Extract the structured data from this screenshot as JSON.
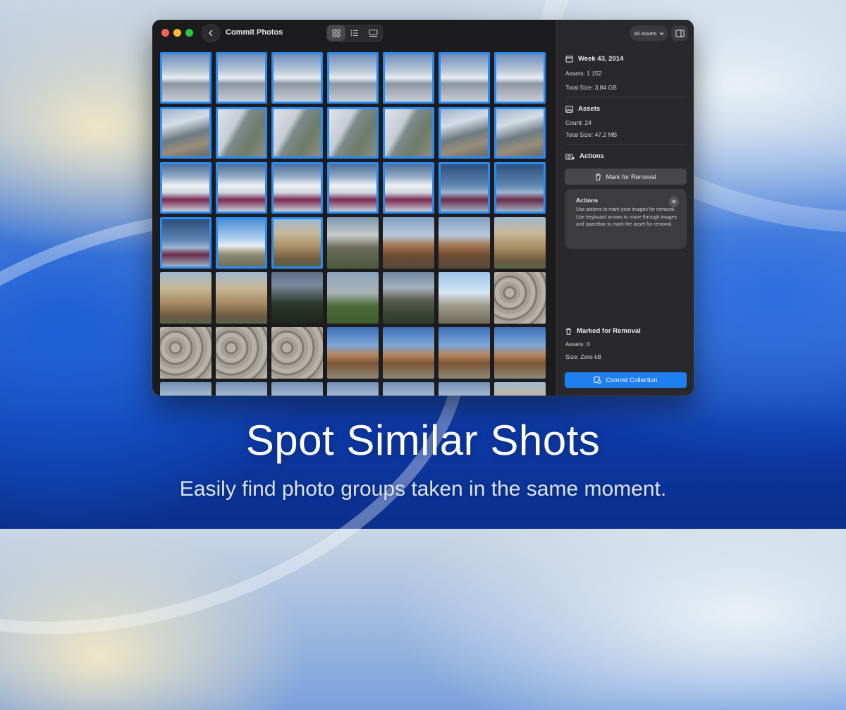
{
  "window": {
    "title": "Commit Photos"
  },
  "colors": {
    "accent": "#1f7ef0",
    "selection": "#2b8bf5",
    "sidebar_bg": "#29292c"
  },
  "toolbar": {
    "back_icon": "chevron-left-icon",
    "views": [
      {
        "icon": "grid-icon",
        "active": true
      },
      {
        "icon": "list-icon",
        "active": false
      },
      {
        "icon": "gallery-icon",
        "active": false
      }
    ]
  },
  "sidebar": {
    "filter_label": "All Assets",
    "week": {
      "title": "Week 43, 2014",
      "assets": "Assets: 1 152",
      "size": "Total Size: 3,84 GB"
    },
    "assets": {
      "title": "Assets",
      "count": "Count: 24",
      "size": "Total Size: 47,2 MB"
    },
    "actions": {
      "title": "Actions",
      "mark_button": "Mark for Removal",
      "tip_title": "Actions",
      "tip_body": "Use actions to mark your images for removal. Use keyboard arrows to move through images and spacebar to mark the asset for removal."
    },
    "marked": {
      "title": "Marked for Removal",
      "assets": "Assets: 0",
      "size": "Size: Zero kB"
    },
    "commit_button": "Commit Collection"
  },
  "thumbnails": [
    {
      "kind": "sky1",
      "selected": true
    },
    {
      "kind": "sky1",
      "selected": true
    },
    {
      "kind": "sky1",
      "selected": true
    },
    {
      "kind": "sky1",
      "selected": true
    },
    {
      "kind": "sky1",
      "selected": true
    },
    {
      "kind": "sky1",
      "selected": true
    },
    {
      "kind": "sky1",
      "selected": true
    },
    {
      "kind": "sky2",
      "selected": true
    },
    {
      "kind": "wing",
      "selected": true
    },
    {
      "kind": "wing",
      "selected": true
    },
    {
      "kind": "wing",
      "selected": true
    },
    {
      "kind": "wing",
      "selected": true
    },
    {
      "kind": "sky2",
      "selected": true
    },
    {
      "kind": "sky2",
      "selected": true
    },
    {
      "kind": "cloud",
      "selected": true
    },
    {
      "kind": "cloud",
      "selected": true
    },
    {
      "kind": "cloud",
      "selected": true
    },
    {
      "kind": "cloud",
      "selected": true
    },
    {
      "kind": "cloud",
      "selected": true
    },
    {
      "kind": "blue",
      "selected": true
    },
    {
      "kind": "blue",
      "selected": true
    },
    {
      "kind": "blue",
      "selected": true
    },
    {
      "kind": "city",
      "selected": true
    },
    {
      "kind": "arch",
      "selected": true
    },
    {
      "kind": "ruin",
      "selected": false
    },
    {
      "kind": "colo",
      "selected": false
    },
    {
      "kind": "colo",
      "selected": false
    },
    {
      "kind": "arch",
      "selected": false
    },
    {
      "kind": "arch",
      "selected": false
    },
    {
      "kind": "arch",
      "selected": false
    },
    {
      "kind": "dark",
      "selected": false
    },
    {
      "kind": "green",
      "selected": false
    },
    {
      "kind": "dusk",
      "selected": false
    },
    {
      "kind": "people",
      "selected": false
    },
    {
      "kind": "stone",
      "selected": false
    },
    {
      "kind": "stone",
      "selected": false
    },
    {
      "kind": "stone",
      "selected": false
    },
    {
      "kind": "stone",
      "selected": false
    },
    {
      "kind": "colo2",
      "selected": false
    },
    {
      "kind": "colo2",
      "selected": false
    },
    {
      "kind": "colo2",
      "selected": false
    },
    {
      "kind": "colo2",
      "selected": false
    },
    {
      "kind": "sky1",
      "selected": false
    },
    {
      "kind": "sky1",
      "selected": false
    },
    {
      "kind": "sky1",
      "selected": false
    },
    {
      "kind": "sky1",
      "selected": false
    },
    {
      "kind": "sky1",
      "selected": false
    },
    {
      "kind": "sky1",
      "selected": false
    },
    {
      "kind": "arch",
      "selected": false
    }
  ],
  "promo": {
    "headline": "Spot Similar Shots",
    "subline": "Easily find photo groups taken in the same moment."
  }
}
